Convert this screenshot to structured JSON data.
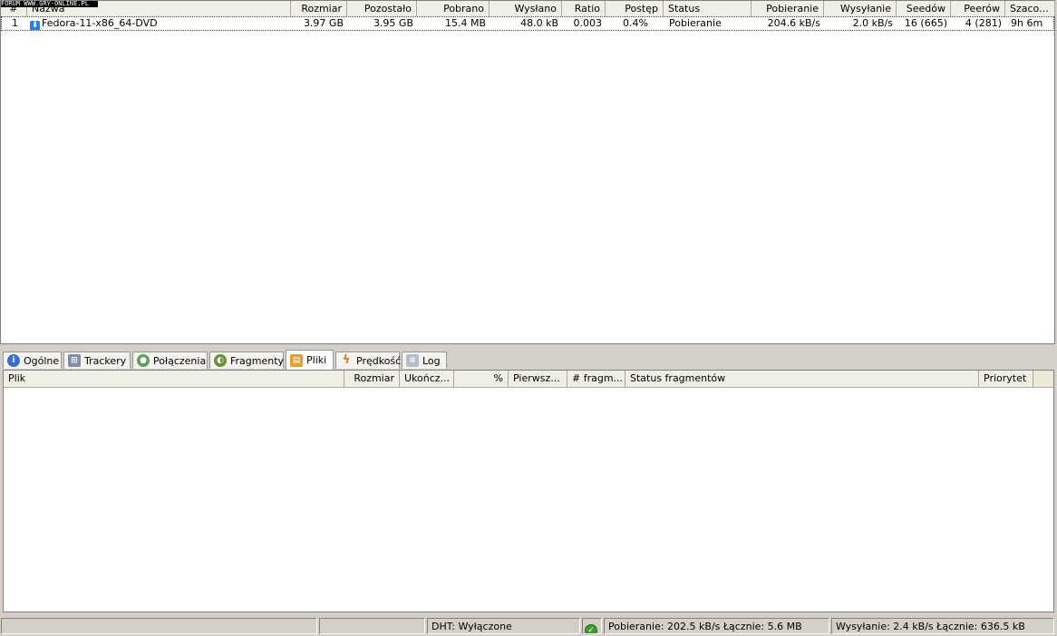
{
  "watermark": "FORUM WWW.GRY-ONLINE.PL",
  "torrent_list": {
    "columns": [
      "#",
      "Nazwa",
      "Rozmiar",
      "Pozostało",
      "Pobrano",
      "Wysłano",
      "Ratio",
      "Postęp",
      "Status",
      "Pobieranie",
      "Wysyłanie",
      "Seedów",
      "Peerów",
      "Szaco..."
    ],
    "rows": [
      {
        "index": "1",
        "icon": "download-arrow-icon",
        "name": "Fedora-11-x86_64-DVD",
        "size": "3.97 GB",
        "remaining": "3.95 GB",
        "downloaded": "15.4 MB",
        "uploaded": "48.0 kB",
        "ratio": "0.003",
        "progress": "0.4%",
        "status": "Pobieranie",
        "download_speed": "204.6 kB/s",
        "upload_speed": "2.0 kB/s",
        "seeds": "16 (665)",
        "peers": "4 (281)",
        "eta": "9h 6m"
      }
    ]
  },
  "tabs": [
    {
      "label": "Ogólne",
      "icon": "info-icon"
    },
    {
      "label": "Trackery",
      "icon": "network-icon"
    },
    {
      "label": "Połączenia",
      "icon": "users-icon"
    },
    {
      "label": "Fragmenty",
      "icon": "pieces-icon"
    },
    {
      "label": "Pliki",
      "icon": "files-icon",
      "active": true
    },
    {
      "label": "Prędkość",
      "icon": "speed-icon"
    },
    {
      "label": "Log",
      "icon": "log-icon"
    }
  ],
  "files_panel": {
    "columns": [
      "Plik",
      "Rozmiar",
      "Ukończ...",
      "%",
      "Pierwsz...",
      "# fragm...",
      "Status fragmentów",
      "Priorytet"
    ]
  },
  "status_bar": {
    "dht": "DHT: Wyłączone",
    "download": "Pobieranie: 202.5 kB/s Łącznie: 5.6 MB",
    "upload": "Wysyłanie: 2.4 kB/s Łącznie: 636.5 kB"
  },
  "colors": {
    "window_bg": "#d4d0c8",
    "header_bg": "#ece9d8",
    "ok_green": "#3c9a3c",
    "download_blue": "#2b7fd8"
  }
}
